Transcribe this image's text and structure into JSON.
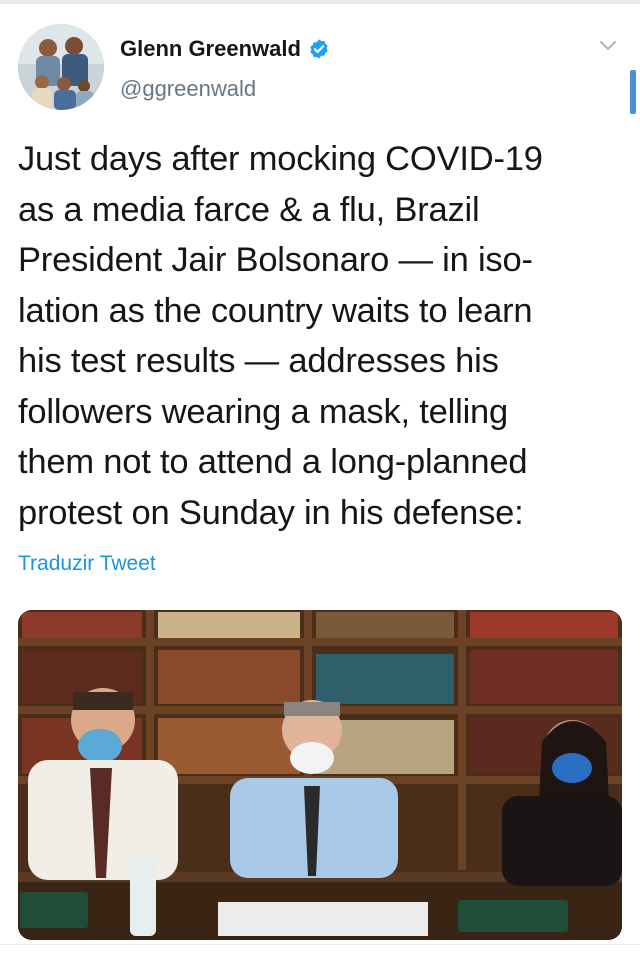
{
  "tweet": {
    "author": {
      "display_name": "Glenn Greenwald",
      "handle": "@ggreenwald",
      "verified": true
    },
    "text": "Just days after mocking COVID-19\nas a media farce & a flu, Brazil\nPresident Jair Bolsonaro — in iso-\nlation as the country waits to learn\nhis test results — addresses his\nfollowers wearing a mask, telling\nthem not to attend a long-planned\nprotest on Sunday in his defense:",
    "translate_label": "Traduzir Tweet"
  },
  "icons": {
    "verified": "verified-badge-icon",
    "menu": "chevron-down-icon"
  },
  "colors": {
    "accent": "#1da1f2",
    "link": "#1b95e0",
    "handle": "#657786",
    "text": "#14171a"
  }
}
